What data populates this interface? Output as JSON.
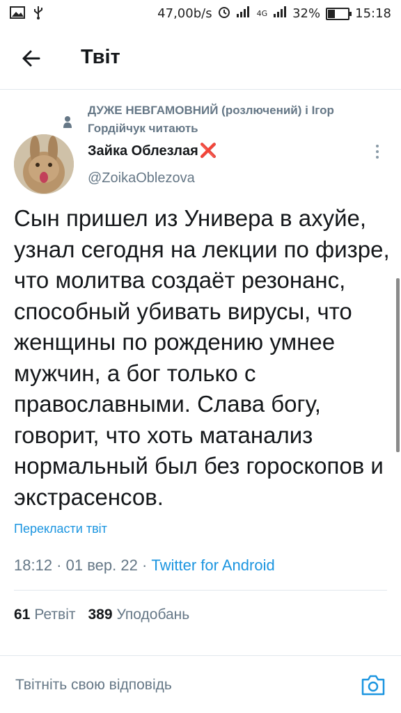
{
  "status_bar": {
    "speed": "47,00b/s",
    "network": "4G",
    "battery": "32%",
    "battery_level": 0.32,
    "time": "15:18"
  },
  "header": {
    "title": "Твіт"
  },
  "social_context": "ДУЖЕ НЕВГАМОВНИЙ (розлючений) і Ігор Гордійчук читають",
  "author": {
    "name": "Зайка Облезлая",
    "name_emoji": "❌",
    "handle": "@ZoikaOblezova"
  },
  "tweet": {
    "text": "Сын пришел из Универа в ахуйе, узнал сегодня на лекции по физре, что молитва создаёт резонанс, способный убивать вирусы, что женщины по рождению умнее мужчин, а бог только с православными. Слава богу, говорит, что хоть матанализ нормальный был без гороскопов и экстрасенсов.",
    "translate": "Перекласти твіт",
    "time": "18:12",
    "date": "01 вер. 22",
    "source": "Twitter for Android"
  },
  "stats": {
    "retweets": "61",
    "retweets_label": "Ретвіт",
    "likes": "389",
    "likes_label": "Уподобань"
  },
  "reply": {
    "placeholder": "Твітніть свою відповідь"
  },
  "colors": {
    "accent": "#1b95e0",
    "secondary_text": "#657786",
    "primary_text": "#14171a",
    "divider": "#e1e8ed"
  },
  "icons": {
    "back": "arrow-left-icon",
    "social": "person-icon",
    "more": "more-vertical-icon",
    "camera": "camera-icon"
  }
}
